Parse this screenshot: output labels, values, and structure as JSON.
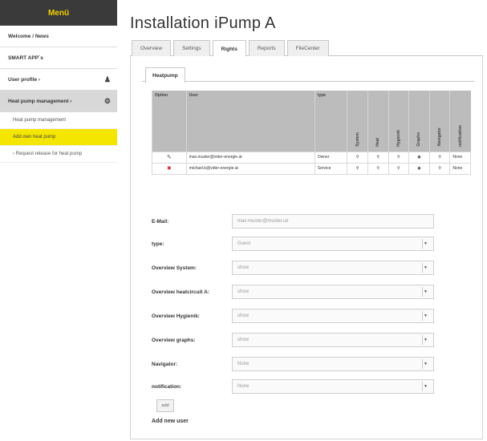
{
  "sidebar": {
    "header": "Menü",
    "items": [
      {
        "label": "Welcome / News"
      },
      {
        "label": "SMART APP´s"
      },
      {
        "label": "User profile ›"
      },
      {
        "label": "Heat pump management ›"
      }
    ],
    "subitems": [
      {
        "label": "Heat pump management"
      },
      {
        "label": "Add own heat pump"
      },
      {
        "label": "› Request release for heat pump"
      }
    ]
  },
  "page": {
    "title": "Installation iPump A"
  },
  "tabs": [
    {
      "label": "Overview"
    },
    {
      "label": "Settings"
    },
    {
      "label": "Rights"
    },
    {
      "label": "Reports"
    },
    {
      "label": "FileCenter"
    }
  ],
  "subtab": {
    "label": "Heatpump"
  },
  "table": {
    "headers": {
      "option": "Option",
      "user": "User",
      "type": "type"
    },
    "rotated_headers": [
      "System",
      "Heat",
      "Hygienik",
      "Graphs",
      "Navigator",
      "notification"
    ],
    "rows": [
      {
        "icon": "edit-icon",
        "user": "max.muster@vider-energie.at",
        "type": "Owner",
        "perms": [
          "⚲",
          "⚲",
          "⚲",
          "◉",
          "⚲"
        ],
        "notification": "None"
      },
      {
        "icon": "delete-icon",
        "user": "michael.b@vider-energie.at",
        "type": "Service",
        "perms": [
          "⚲",
          "⚲",
          "⚲",
          "◉",
          "⚲"
        ],
        "notification": "None"
      }
    ]
  },
  "form": {
    "email": {
      "label": "E-Mail:",
      "placeholder": "max.muster@muster.uk"
    },
    "type": {
      "label": "type:",
      "value": "Guest"
    },
    "overview_system": {
      "label": "Overview System:",
      "value": "show"
    },
    "overview_heatcircuit": {
      "label": "Overview heatcircuit A:",
      "value": "show"
    },
    "overview_hygienik": {
      "label": "Overview Hygienik:",
      "value": "show"
    },
    "overview_graphs": {
      "label": "Overview graphs:",
      "value": "show"
    },
    "navigator": {
      "label": "Navigator:",
      "value": "None"
    },
    "notification": {
      "label": "notification:",
      "value": "None"
    },
    "add_button": "add",
    "add_label": "Add new user"
  },
  "colors": {
    "menu_header_bg": "#3a3a3a",
    "menu_header_text": "#f3d100",
    "highlight": "#f5e600",
    "delete": "#d42020"
  }
}
